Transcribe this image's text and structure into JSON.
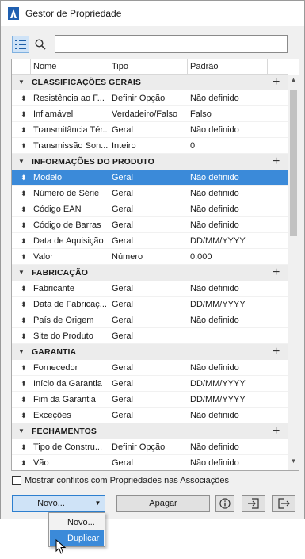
{
  "window": {
    "title": "Gestor de Propriedade"
  },
  "toolbar": {
    "search_value": ""
  },
  "table": {
    "headers": [
      "Nome",
      "Tipo",
      "Padrão"
    ],
    "rows": [
      {
        "kind": "group",
        "label": "CLASSIFICAÇÕES GERAIS"
      },
      {
        "kind": "item",
        "name": "Resistência ao F...",
        "type": "Definir Opção",
        "default": "Não definido"
      },
      {
        "kind": "item",
        "name": "Inflamável",
        "type": "Verdadeiro/Falso",
        "default": "Falso"
      },
      {
        "kind": "item",
        "name": "Transmitância Tér...",
        "type": "Geral",
        "default": "Não definido"
      },
      {
        "kind": "item",
        "name": "Transmissão Son...",
        "type": "Inteiro",
        "default": "0"
      },
      {
        "kind": "group",
        "label": "INFORMAÇÕES DO PRODUTO"
      },
      {
        "kind": "item",
        "name": "Modelo",
        "type": "Geral",
        "default": "Não definido",
        "selected": true
      },
      {
        "kind": "item",
        "name": "Número de Série",
        "type": "Geral",
        "default": "Não definido"
      },
      {
        "kind": "item",
        "name": "Código EAN",
        "type": "Geral",
        "default": "Não definido"
      },
      {
        "kind": "item",
        "name": "Código de Barras",
        "type": "Geral",
        "default": "Não definido"
      },
      {
        "kind": "item",
        "name": "Data de Aquisição",
        "type": "Geral",
        "default": "DD/MM/YYYY"
      },
      {
        "kind": "item",
        "name": "Valor",
        "type": "Número",
        "default": "0.000"
      },
      {
        "kind": "group",
        "label": "FABRICAÇÃO"
      },
      {
        "kind": "item",
        "name": "Fabricante",
        "type": "Geral",
        "default": "Não definido"
      },
      {
        "kind": "item",
        "name": "Data de Fabricaç...",
        "type": "Geral",
        "default": "DD/MM/YYYY"
      },
      {
        "kind": "item",
        "name": "País de Origem",
        "type": "Geral",
        "default": "Não definido"
      },
      {
        "kind": "item",
        "name": "Site do Produto",
        "type": "Geral",
        "default": ""
      },
      {
        "kind": "group",
        "label": "GARANTIA"
      },
      {
        "kind": "item",
        "name": "Fornecedor",
        "type": "Geral",
        "default": "Não definido"
      },
      {
        "kind": "item",
        "name": "Início da Garantia",
        "type": "Geral",
        "default": "DD/MM/YYYY"
      },
      {
        "kind": "item",
        "name": "Fim da Garantia",
        "type": "Geral",
        "default": "DD/MM/YYYY"
      },
      {
        "kind": "item",
        "name": "Exceções",
        "type": "Geral",
        "default": "Não definido"
      },
      {
        "kind": "group",
        "label": "FECHAMENTOS"
      },
      {
        "kind": "item",
        "name": "Tipo de Constru...",
        "type": "Definir Opção",
        "default": "Não definido"
      },
      {
        "kind": "item",
        "name": "Vão",
        "type": "Geral",
        "default": "Não definido"
      }
    ]
  },
  "footer": {
    "conflict_label": "Mostrar conflitos com Propriedades nas Associações",
    "novo_label": "Novo...",
    "apagar_label": "Apagar"
  },
  "dropdown": {
    "items": [
      "Novo...",
      "Duplicar"
    ]
  },
  "colors": {
    "accent": "#3b8ad9",
    "selected_button": "#cfe3f7"
  }
}
